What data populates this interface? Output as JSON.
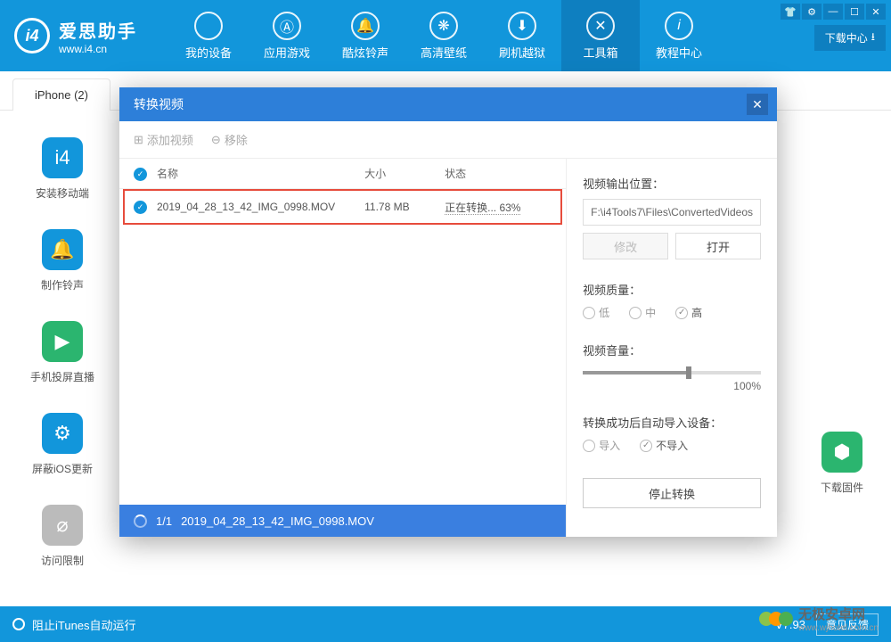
{
  "app": {
    "title": "爱思助手",
    "subtitle": "www.i4.cn"
  },
  "nav": {
    "items": [
      {
        "label": "我的设备",
        "icon": ""
      },
      {
        "label": "应用游戏",
        "icon": "ⓐ"
      },
      {
        "label": "酷炫铃声",
        "icon": "🔔"
      },
      {
        "label": "高清壁纸",
        "icon": "❋"
      },
      {
        "label": "刷机越狱",
        "icon": "⌄"
      },
      {
        "label": "工具箱",
        "icon": "✕"
      },
      {
        "label": "教程中心",
        "icon": "i"
      }
    ],
    "download_center": "下载中心"
  },
  "tabs": {
    "main": "iPhone (2)"
  },
  "sidebar": {
    "items": [
      {
        "label": "安装移动端"
      },
      {
        "label": "制作铃声"
      },
      {
        "label": "手机投屏直播"
      },
      {
        "label": "屏蔽iOS更新"
      },
      {
        "label": "访问限制"
      }
    ],
    "right": [
      {
        "label": "下载固件"
      }
    ]
  },
  "modal": {
    "title": "转换视频",
    "toolbar": {
      "add": "添加视频",
      "remove": "移除"
    },
    "columns": {
      "name": "名称",
      "size": "大小",
      "status": "状态"
    },
    "rows": [
      {
        "name": "2019_04_28_13_42_IMG_0998.MOV",
        "size": "11.78 MB",
        "status": "正在转换... 63%"
      }
    ],
    "footer": {
      "count": "1/1",
      "file": "2019_04_28_13_42_IMG_0998.MOV"
    },
    "settings": {
      "output_label": "视频输出位置：",
      "output_path": "F:\\i4Tools7\\Files\\ConvertedVideos",
      "modify": "修改",
      "open": "打开",
      "quality_label": "视频质量：",
      "quality_low": "低",
      "quality_mid": "中",
      "quality_high": "高",
      "volume_label": "视频音量：",
      "volume_value": "100%",
      "import_label": "转换成功后自动导入设备：",
      "import_yes": "导入",
      "import_no": "不导入",
      "stop": "停止转换"
    }
  },
  "status": {
    "left": "阻止iTunes自动运行",
    "version": "V7.93",
    "feedback": "意见反馈"
  },
  "watermark": {
    "text": "无极安卓网",
    "url": "www.wjhotel.com.cn"
  }
}
